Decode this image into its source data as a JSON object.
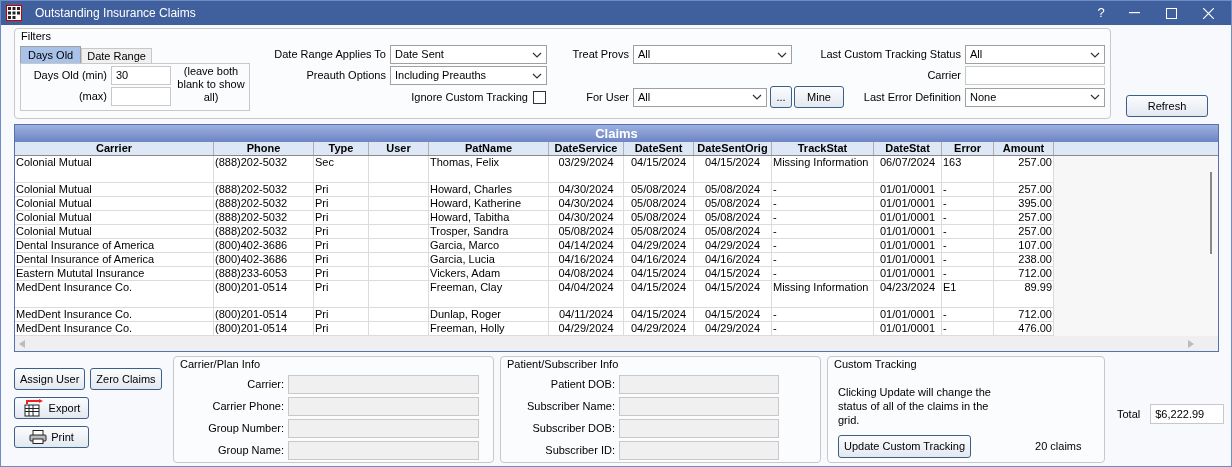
{
  "window": {
    "title": "Outstanding Insurance Claims",
    "help": "?"
  },
  "filters": {
    "title": "Filters",
    "tabs": [
      {
        "label": "Days Old",
        "selected": true
      },
      {
        "label": "Date Range",
        "selected": false
      }
    ],
    "days_old_min": {
      "label": "Days Old (min)",
      "value": "30"
    },
    "days_old_max": {
      "label": "(max)"
    },
    "hint": "(leave both blank to show all)",
    "date_range_applies_to": {
      "label": "Date Range Applies To",
      "value": "Date Sent"
    },
    "preauth_options": {
      "label": "Preauth Options",
      "value": "Including Preauths"
    },
    "ignore_custom_tracking": {
      "label": "Ignore Custom Tracking",
      "checked": false
    },
    "treat_provs": {
      "label": "Treat Provs",
      "value": "All"
    },
    "for_user": {
      "label": "For User",
      "value": "All"
    },
    "ellipsis_button": "...",
    "mine_button": "Mine",
    "last_custom_tracking_status": {
      "label": "Last Custom Tracking Status",
      "value": "All"
    },
    "carrier": {
      "label": "Carrier"
    },
    "last_error_definition": {
      "label": "Last Error Definition",
      "value": "None"
    }
  },
  "refresh_button": "Refresh",
  "grid": {
    "title": "Claims",
    "columns": [
      "Carrier",
      "Phone",
      "Type",
      "User",
      "PatName",
      "DateService",
      "DateSent",
      "DateSentOrig",
      "TrackStat",
      "DateStat",
      "Error",
      "Amount"
    ],
    "rows": [
      [
        "Colonial Mutual",
        "(888)202-5032",
        "Sec",
        "",
        "Thomas, Felix",
        "03/29/2024",
        "04/15/2024",
        "04/15/2024",
        "Missing Information",
        "06/07/2024",
        "163",
        "257.00"
      ],
      [
        "Colonial Mutual",
        "(888)202-5032",
        "Pri",
        "",
        "Howard, Charles",
        "04/30/2024",
        "05/08/2024",
        "05/08/2024",
        "-",
        "01/01/0001",
        "-",
        "257.00"
      ],
      [
        "Colonial Mutual",
        "(888)202-5032",
        "Pri",
        "",
        "Howard, Katherine",
        "04/30/2024",
        "05/08/2024",
        "05/08/2024",
        "-",
        "01/01/0001",
        "-",
        "395.00"
      ],
      [
        "Colonial Mutual",
        "(888)202-5032",
        "Pri",
        "",
        "Howard, Tabitha",
        "04/30/2024",
        "05/08/2024",
        "05/08/2024",
        "-",
        "01/01/0001",
        "-",
        "257.00"
      ],
      [
        "Colonial Mutual",
        "(888)202-5032",
        "Pri",
        "",
        "Trosper, Sandra",
        "05/08/2024",
        "05/08/2024",
        "05/08/2024",
        "-",
        "01/01/0001",
        "-",
        "257.00"
      ],
      [
        "Dental Insurance of America",
        "(800)402-3686",
        "Pri",
        "",
        "Garcia, Marco",
        "04/14/2024",
        "04/29/2024",
        "04/29/2024",
        "-",
        "01/01/0001",
        "-",
        "107.00"
      ],
      [
        "Dental Insurance of America",
        "(800)402-3686",
        "Pri",
        "",
        "Garcia, Lucia",
        "04/16/2024",
        "04/16/2024",
        "04/16/2024",
        "-",
        "01/01/0001",
        "-",
        "238.00"
      ],
      [
        "Eastern Mututal Insurance",
        "(888)233-6053",
        "Pri",
        "",
        "Vickers, Adam",
        "04/08/2024",
        "04/15/2024",
        "04/15/2024",
        "-",
        "01/01/0001",
        "-",
        "712.00"
      ],
      [
        "MedDent Insurance Co.",
        "(800)201-0514",
        "Pri",
        "",
        "Freeman, Clay",
        "04/04/2024",
        "04/15/2024",
        "04/15/2024",
        "Missing Information",
        "04/23/2024",
        "E1",
        "89.99"
      ],
      [
        "MedDent Insurance Co.",
        "(800)201-0514",
        "Pri",
        "",
        "Dunlap, Roger",
        "04/11/2024",
        "04/15/2024",
        "04/15/2024",
        "-",
        "01/01/0001",
        "-",
        "712.00"
      ],
      [
        "MedDent Insurance Co.",
        "(800)201-0514",
        "Pri",
        "",
        "Freeman, Holly",
        "04/29/2024",
        "04/29/2024",
        "04/29/2024",
        "-",
        "01/01/0001",
        "-",
        "476.00"
      ]
    ]
  },
  "action_buttons": [
    "Assign User",
    "Zero Claims"
  ],
  "export_button": "Export",
  "print_button": "Print",
  "carrier_plan_info": {
    "title": "Carrier/Plan Info",
    "fields": [
      "Carrier:",
      "Carrier Phone:",
      "Group Number:",
      "Group Name:"
    ]
  },
  "patient_subscriber_info": {
    "title": "Patient/Subscriber Info",
    "fields": [
      "Patient DOB:",
      "Subscriber Name:",
      "Subscriber DOB:",
      "Subscriber ID:"
    ]
  },
  "custom_tracking": {
    "title": "Custom Tracking",
    "note": "Clicking Update will change the status of all of the claims in the grid.",
    "button": "Update Custom Tracking",
    "count": "20 claims"
  },
  "total": {
    "label": "Total",
    "value": "$6,222.99"
  }
}
